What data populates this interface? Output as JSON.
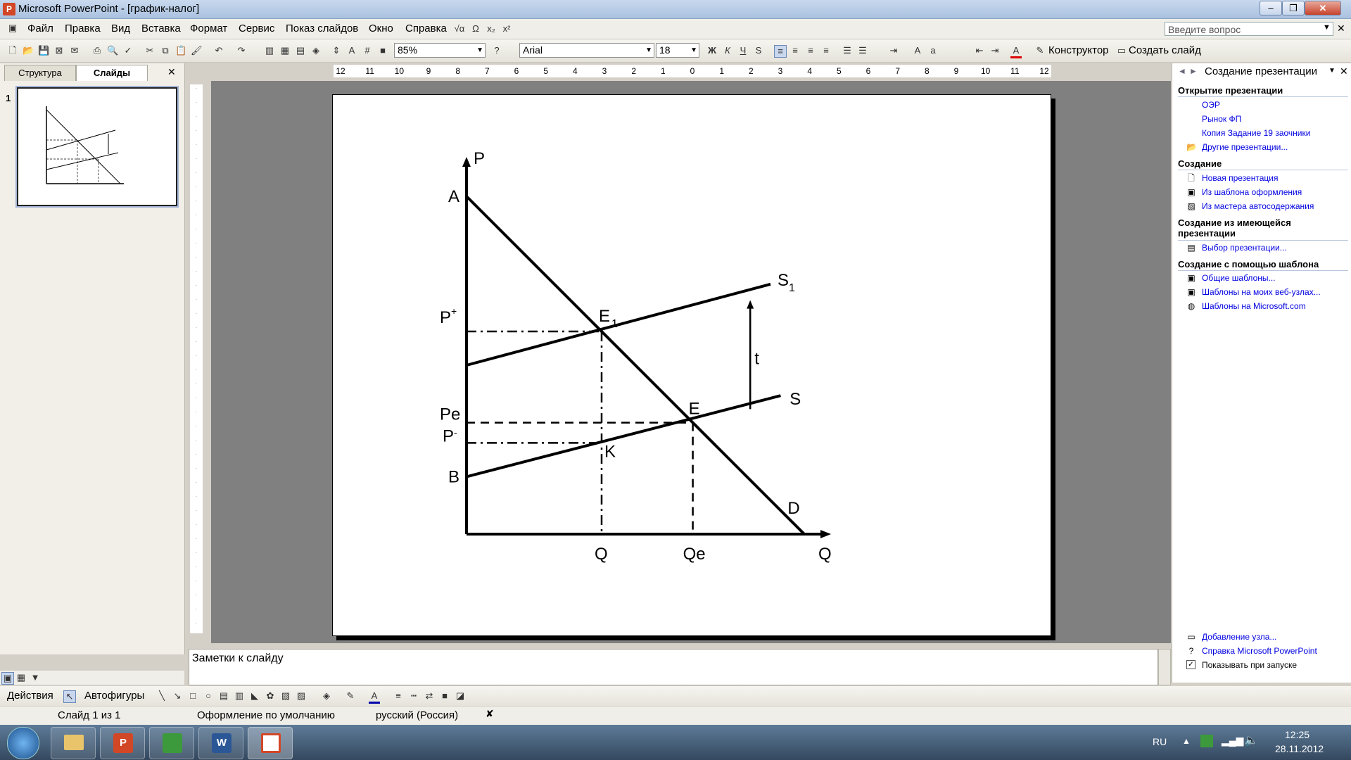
{
  "window": {
    "title": "Microsoft PowerPoint - [график-налог]"
  },
  "menu": [
    "Файл",
    "Правка",
    "Вид",
    "Вставка",
    "Формат",
    "Сервис",
    "Показ слайдов",
    "Окно",
    "Справка"
  ],
  "help_placeholder": "Введите вопрос",
  "toolbar": {
    "zoom": "85%",
    "font": "Arial",
    "font_size": "18",
    "designer_label": "Конструктор",
    "new_slide_label": "Создать слайд"
  },
  "left_panel": {
    "tabs": [
      "Структура",
      "Слайды"
    ],
    "slide_number": "1"
  },
  "ruler_labels": [
    "12",
    "11",
    "10",
    "9",
    "8",
    "7",
    "6",
    "5",
    "4",
    "3",
    "2",
    "1",
    "0",
    "1",
    "2",
    "3",
    "4",
    "5",
    "6",
    "7",
    "8",
    "9",
    "10",
    "11",
    "12"
  ],
  "chart_data": {
    "type": "line",
    "labels": {
      "y_axis": "P",
      "x_axis": "Q",
      "A": "A",
      "B": "B",
      "D": "D",
      "E": "E",
      "E1": "E",
      "E1_sub": "1",
      "S": "S",
      "S1": "S",
      "S1_sub": "1",
      "K": "K",
      "t": "t",
      "P_plus": "P",
      "P_plus_sup": "+",
      "Pe": "Pe",
      "P_minus": "P",
      "P_minus_sup": "-",
      "Q_tick": "Q",
      "Qe_tick": "Qe"
    },
    "series": [
      {
        "name": "D",
        "x": [
          0,
          1
        ],
        "y": [
          1,
          0
        ]
      },
      {
        "name": "S",
        "x": [
          0,
          0.93
        ],
        "y": [
          0.17,
          0.41
        ]
      },
      {
        "name": "S1",
        "x": [
          0,
          0.9
        ],
        "y": [
          0.5,
          0.74
        ]
      }
    ],
    "points": {
      "E1": [
        0.4,
        0.6
      ],
      "E": [
        0.67,
        0.33
      ],
      "K": [
        0.4,
        0.27
      ]
    }
  },
  "task_pane": {
    "title": "Создание презентации",
    "sections": [
      {
        "header": "Открытие презентации",
        "links": [
          "ОЭР",
          "Рынок ФП",
          "Копия Задание 19 заочники",
          "Другие презентации..."
        ]
      },
      {
        "header": "Создание",
        "links": [
          "Новая презентация",
          "Из шаблона оформления",
          "Из мастера автосодержания"
        ]
      },
      {
        "header": "Создание из имеющейся презентации",
        "links": [
          "Выбор презентации..."
        ]
      },
      {
        "header": "Создание с помощью шаблона",
        "links": [
          "Общие шаблоны...",
          "Шаблоны на моих веб-узлах...",
          "Шаблоны на Microsoft.com"
        ]
      }
    ],
    "bottom_links": [
      "Добавление узла...",
      "Справка Microsoft PowerPoint"
    ],
    "show_on_start": "Показывать при запуске"
  },
  "notes_placeholder": "Заметки к слайду",
  "drawbar": {
    "actions": "Действия",
    "autoshapes": "Автофигуры"
  },
  "status": {
    "slide": "Слайд 1 из 1",
    "design": "Оформление по умолчанию",
    "language": "русский (Россия)"
  },
  "taskbar": {
    "lang": "RU",
    "time": "12:25",
    "date": "28.11.2012"
  }
}
